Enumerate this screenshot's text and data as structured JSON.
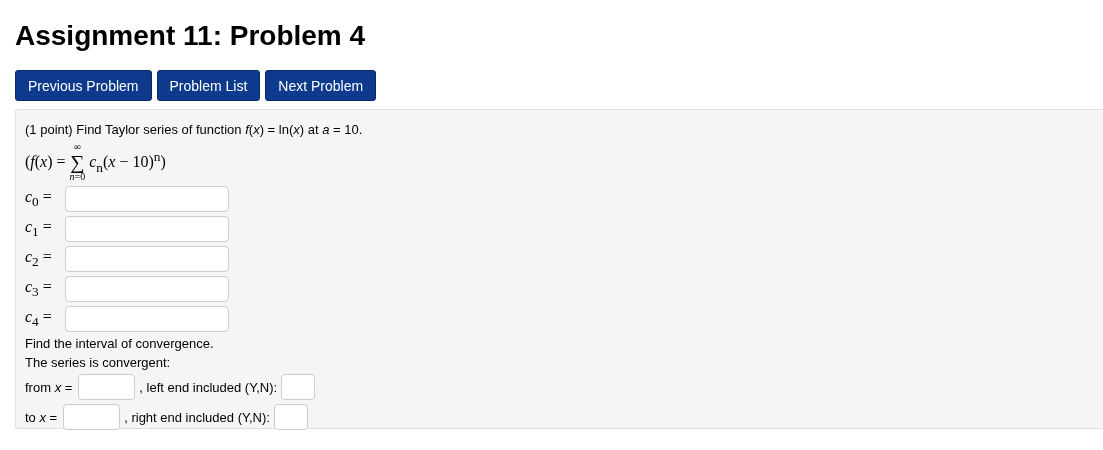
{
  "title": "Assignment 11: Problem 4",
  "nav_buttons": [
    "Previous Problem",
    "Problem List",
    "Next Problem"
  ],
  "problem": {
    "statement": "(1 point) Find Taylor series of function *f*(*x*) = ln(*x*) at *a* = 10.",
    "formula": {
      "lhs": "(*f*(*x*) =",
      "sum_symbol": "∑",
      "upper": "∞",
      "lower": "*n*=0",
      "rhs": "*c*$_{n}$(*x* − 10)$^{n}$)"
    },
    "coefficients": [
      {
        "label": "*c*$_{0}$ ="
      },
      {
        "label": "*c*$_{1}$ ="
      },
      {
        "label": "*c*$_{2}$ ="
      },
      {
        "label": "*c*$_{3}$ ="
      },
      {
        "label": "*c*$_{4}$ ="
      }
    ],
    "interval_heading": "Find the interval of convergence.",
    "interval_intro": "The series is convergent:",
    "endpoints": [
      {
        "label": "from *x* =",
        "included_label": ", left end included (Y,N):"
      },
      {
        "label": "to *x* =",
        "included_label": ", right end included (Y,N):"
      }
    ]
  }
}
